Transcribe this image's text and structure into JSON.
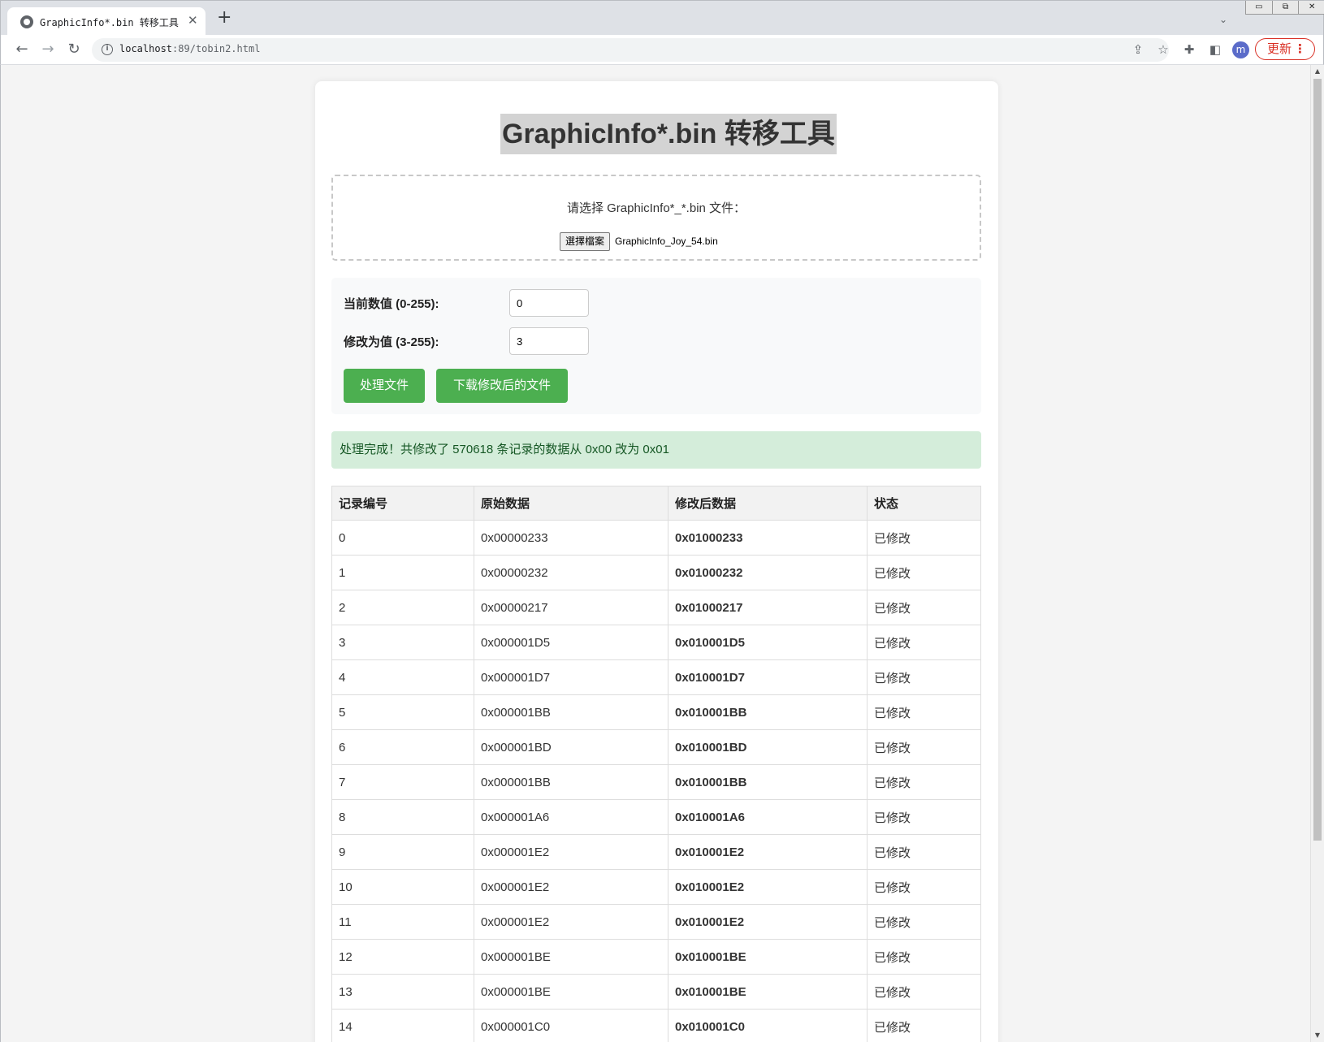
{
  "browser": {
    "tab_title": "GraphicInfo*.bin 转移工具",
    "url_host": "localhost",
    "url_port": ":89",
    "url_path": "/tobin2.html",
    "avatar_letter": "m",
    "update_label": "更新"
  },
  "page": {
    "title": "GraphicInfo*.bin 转移工具",
    "upload_label": "请选择 GraphicInfo*_*.bin 文件：",
    "file_button_label": "選擇檔案",
    "file_name": "GraphicInfo_Joy_54.bin"
  },
  "form": {
    "current_label": "当前数值 (0-255):",
    "current_value": "0",
    "new_label": "修改为值 (3-255):",
    "new_value": "3",
    "process_button": "处理文件",
    "download_button": "下载修改后的文件"
  },
  "result": {
    "message": "处理完成！共修改了 570618 条记录的数据从 0x00 改为 0x01"
  },
  "table": {
    "headers": [
      "记录编号",
      "原始数据",
      "修改后数据",
      "状态"
    ],
    "rows": [
      [
        "0",
        "0x00000233",
        "0x01000233",
        "已修改"
      ],
      [
        "1",
        "0x00000232",
        "0x01000232",
        "已修改"
      ],
      [
        "2",
        "0x00000217",
        "0x01000217",
        "已修改"
      ],
      [
        "3",
        "0x000001D5",
        "0x010001D5",
        "已修改"
      ],
      [
        "4",
        "0x000001D7",
        "0x010001D7",
        "已修改"
      ],
      [
        "5",
        "0x000001BB",
        "0x010001BB",
        "已修改"
      ],
      [
        "6",
        "0x000001BD",
        "0x010001BD",
        "已修改"
      ],
      [
        "7",
        "0x000001BB",
        "0x010001BB",
        "已修改"
      ],
      [
        "8",
        "0x000001A6",
        "0x010001A6",
        "已修改"
      ],
      [
        "9",
        "0x000001E2",
        "0x010001E2",
        "已修改"
      ],
      [
        "10",
        "0x000001E2",
        "0x010001E2",
        "已修改"
      ],
      [
        "11",
        "0x000001E2",
        "0x010001E2",
        "已修改"
      ],
      [
        "12",
        "0x000001BE",
        "0x010001BE",
        "已修改"
      ],
      [
        "13",
        "0x000001BE",
        "0x010001BE",
        "已修改"
      ],
      [
        "14",
        "0x000001C0",
        "0x010001C0",
        "已修改"
      ]
    ]
  },
  "colors": {
    "accent_green": "#4caf50",
    "modified_blue": "#0000ff",
    "success_bg": "#d4edda",
    "update_red": "#d93025"
  }
}
